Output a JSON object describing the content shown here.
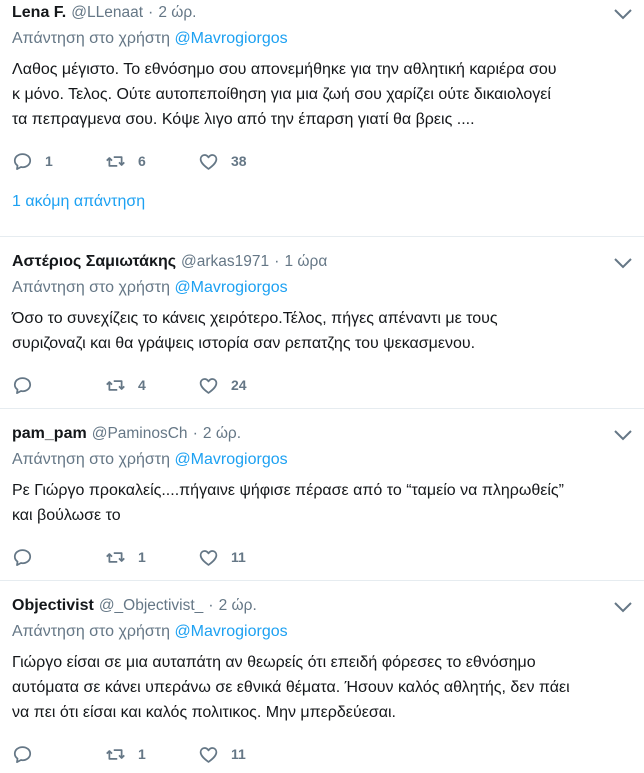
{
  "reply_prefix": "Απάντηση στο χρήστη",
  "tweets": [
    {
      "name": "Lena F.",
      "handle": "@LLenaat",
      "time": "2 ώρ.",
      "reply_to": "@Mavrogiorgos",
      "text": "Λαθος μέγιστο. Το εθνόσημο σου απονεμήθηκε για την αθλητική καριέρα σου\nκ μόνο. Τελος. Ούτε αυτοπεποίθηση για μια ζωή σου χαρίζει ούτε δικαιολογεί\nτα πεπραγμενα σου. Κόψε λιγο από την έπαρση γιατί θα βρεις ....",
      "replies": "1",
      "retweets": "6",
      "likes": "38",
      "more_replies": "1 ακόμη απάντηση"
    },
    {
      "name": "Αστέριος Σαμιωτάκης",
      "handle": "@arkas1971",
      "time": "1 ώρα",
      "reply_to": "@Mavrogiorgos",
      "text": "Όσο το συνεχίζεις το κάνεις χειρότερο.Τέλος, πήγες απέναντι με τους\nσυριζοναζι και θα γράψεις ιστορία σαν ρεπατζης του ψεκασμενου.",
      "replies": "",
      "retweets": "4",
      "likes": "24"
    },
    {
      "name": "pam_pam",
      "handle": "@PaminosCh",
      "time": "2 ώρ.",
      "reply_to": "@Mavrogiorgos",
      "text": "Ρε Γιώργο προκαλείς....πήγαινε ψήφισε πέρασε από το “ταμείο να πληρωθείς”\nκαι βούλωσε το",
      "replies": "",
      "retweets": "1",
      "likes": "11"
    },
    {
      "name": "Objectivist",
      "handle": "@_Objectivist_",
      "time": "2 ώρ.",
      "reply_to": "@Mavrogiorgos",
      "text": "Γιώργο είσαι σε μια αυταπάτη αν θεωρείς ότι επειδή φόρεσες το εθνόσημο\nαυτόματα σε κάνει υπεράνω σε εθνικά θέματα. Ήσουν καλός αθλητής, δεν πάει\nνα πει ότι είσαι και καλός πολιτικος. Μην μπερδεύεσαι.",
      "replies": "",
      "retweets": "1",
      "likes": "11"
    }
  ],
  "colors": {
    "link": "#1da1f2",
    "muted": "#657786",
    "text": "#14171a",
    "divider": "#e6ecf0"
  },
  "icons": [
    "reply-icon",
    "retweet-icon",
    "like-icon",
    "chevron-down-icon"
  ]
}
